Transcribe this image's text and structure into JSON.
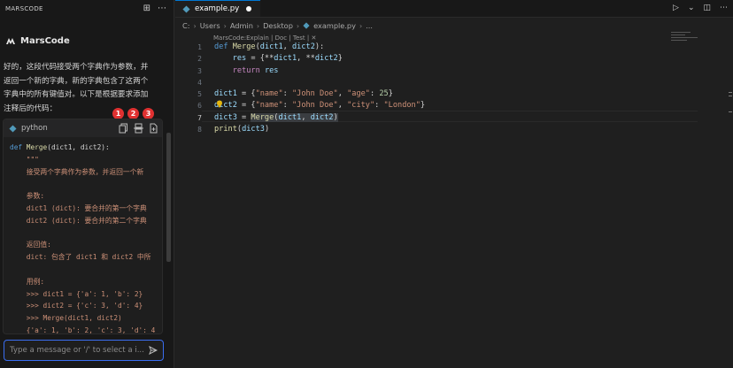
{
  "sidebar": {
    "title": "MARSCODE",
    "brand": "MarsCode",
    "message_lines": [
      "好的，这段代码接受两个字典作为参数，并",
      "返回一个新的字典，新的字典包含了这两个",
      "字典中的所有键值对。以下是根据要求添加",
      "注释后的代码："
    ],
    "code_card": {
      "language": "python",
      "code_lines": [
        "def Merge(dict1, dict2):",
        "    \"\"\"",
        "    接受两个字典作为参数，并返回一个新",
        "",
        "    参数:",
        "    dict1 (dict): 要合并的第一个字典",
        "    dict2 (dict): 要合并的第二个字典",
        "",
        "    返回值:",
        "    dict: 包含了 dict1 和 dict2 中所",
        "",
        "    用例:",
        "    >>> dict1 = {'a': 1, 'b': 2}",
        "    >>> dict2 = {'c': 3, 'd': 4}",
        "    >>> Merge(dict1, dict2)",
        "    {'a': 1, 'b': 2, 'c': 3, 'd': 4"
      ]
    },
    "badges": [
      "1",
      "2",
      "3"
    ],
    "message_input": {
      "placeholder": "Type a message or '/' to select a i..."
    }
  },
  "editor": {
    "tab": {
      "label": "example.py"
    },
    "breadcrumb": [
      "C:",
      "Users",
      "Admin",
      "Desktop",
      "example.py",
      "..."
    ],
    "codelens": "MarsCode:Explain | Doc | Test | ✕",
    "line_numbers": [
      "1",
      "2",
      "3",
      "4",
      "5",
      "6",
      "7",
      "8"
    ]
  },
  "colors": {
    "accent": "#0078d4",
    "badge": "#e03131",
    "input_border": "#3a6df0"
  },
  "icons": [
    "plus-square-icon",
    "more-icon",
    "marscode-logo-icon",
    "python-icon",
    "copy-icon",
    "insert-icon",
    "new-file-icon",
    "send-icon",
    "run-icon",
    "chevron-down-icon",
    "split-editor-icon",
    "lightbulb-icon"
  ]
}
